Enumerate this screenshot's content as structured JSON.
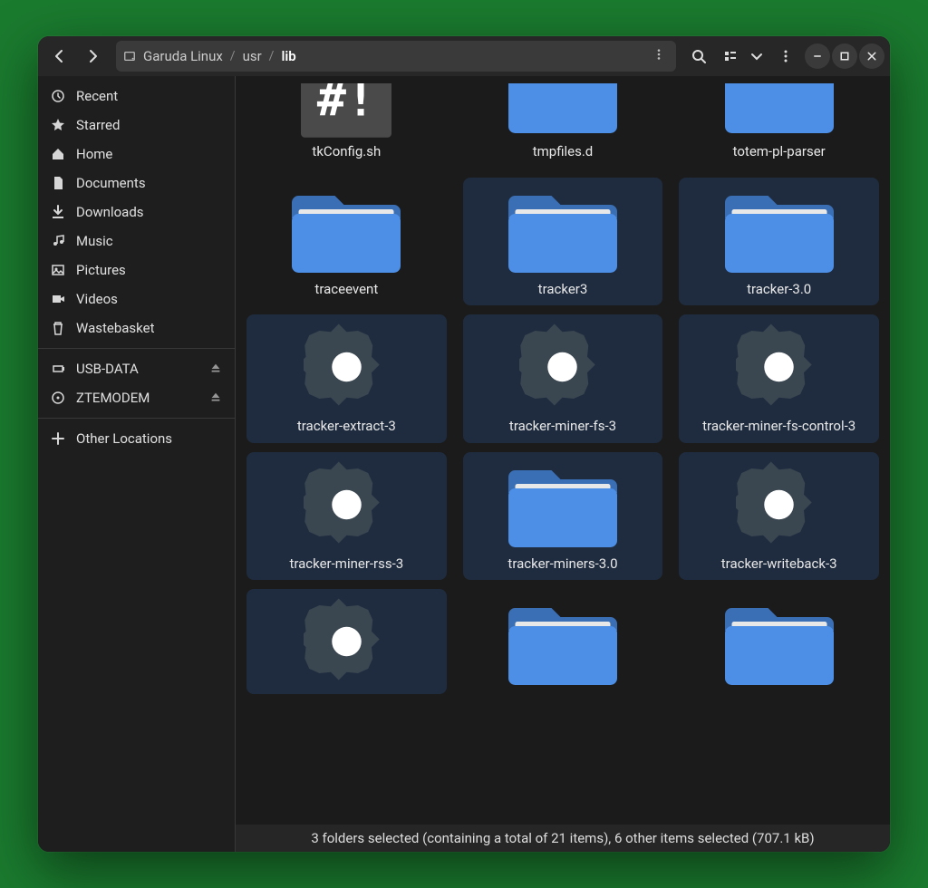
{
  "breadcrumb": {
    "root": "Garuda Linux",
    "parts": [
      "usr",
      "lib"
    ]
  },
  "sidebar": {
    "places": [
      {
        "icon": "clock",
        "label": "Recent"
      },
      {
        "icon": "star",
        "label": "Starred"
      },
      {
        "icon": "home",
        "label": "Home"
      },
      {
        "icon": "doc",
        "label": "Documents"
      },
      {
        "icon": "download",
        "label": "Downloads"
      },
      {
        "icon": "music",
        "label": "Music"
      },
      {
        "icon": "picture",
        "label": "Pictures"
      },
      {
        "icon": "video",
        "label": "Videos"
      },
      {
        "icon": "trash",
        "label": "Wastebasket"
      }
    ],
    "devices": [
      {
        "icon": "usb",
        "label": "USB-DATA",
        "eject": true
      },
      {
        "icon": "disc",
        "label": "ZTEMODEM",
        "eject": true
      }
    ],
    "other": {
      "icon": "plus",
      "label": "Other Locations"
    }
  },
  "files": [
    {
      "name": "tkConfig.sh",
      "type": "script",
      "selected": false,
      "partial": "top"
    },
    {
      "name": "tmpfiles.d",
      "type": "folder",
      "selected": false,
      "partial": "top"
    },
    {
      "name": "totem-pl-parser",
      "type": "folder",
      "selected": false,
      "partial": "top"
    },
    {
      "name": "traceevent",
      "type": "folder",
      "selected": false
    },
    {
      "name": "tracker3",
      "type": "folder",
      "selected": true
    },
    {
      "name": "tracker-3.0",
      "type": "folder",
      "selected": true
    },
    {
      "name": "tracker-extract-3",
      "type": "exec",
      "selected": true
    },
    {
      "name": "tracker-miner-fs-3",
      "type": "exec",
      "selected": true
    },
    {
      "name": "tracker-miner-fs-control-3",
      "type": "exec",
      "selected": true
    },
    {
      "name": "tracker-miner-rss-3",
      "type": "exec",
      "selected": true
    },
    {
      "name": "tracker-miners-3.0",
      "type": "folder",
      "selected": true
    },
    {
      "name": "tracker-writeback-3",
      "type": "exec",
      "selected": true
    },
    {
      "name": "",
      "type": "exec",
      "selected": true,
      "partial": "bottom"
    },
    {
      "name": "",
      "type": "folder",
      "selected": false,
      "partial": "bottom"
    },
    {
      "name": "",
      "type": "folder",
      "selected": false,
      "partial": "bottom"
    }
  ],
  "status": "3 folders selected (containing a total of 21 items), 6 other items selected (707.1 kB)"
}
